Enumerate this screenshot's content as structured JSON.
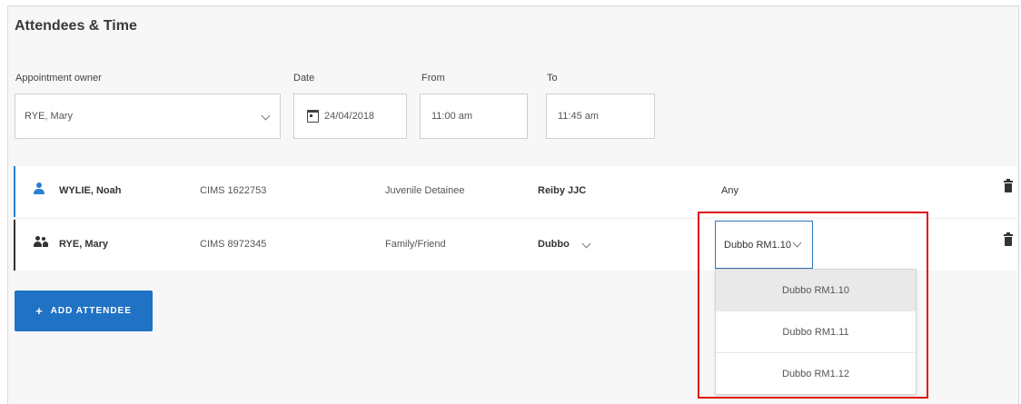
{
  "section": {
    "title": "Attendees & Time"
  },
  "form": {
    "owner_label": "Appointment owner",
    "owner_value": "RYE, Mary",
    "date_label": "Date",
    "date_value": "24/04/2018",
    "from_label": "From",
    "from_value": "11:00 am",
    "to_label": "To",
    "to_value": "11:45 am"
  },
  "attendees": [
    {
      "name": "WYLIE, Noah",
      "cims": "CIMS 1622753",
      "role": "Juvenile Detainee",
      "location": "Reiby JJC",
      "room": "Any",
      "icon": "person-icon"
    },
    {
      "name": "RYE, Mary",
      "cims": "CIMS 8972345",
      "role": "Family/Friend",
      "location": "Dubbo",
      "room": "Dubbo RM1.10",
      "icon": "group-icon"
    }
  ],
  "room_dropdown": {
    "options": [
      "Dubbo RM1.10",
      "Dubbo RM1.11",
      "Dubbo RM1.12"
    ],
    "selected": "Dubbo RM1.10"
  },
  "actions": {
    "add_attendee": "ADD ATTENDEE"
  },
  "colors": {
    "primary": "#1f72c4",
    "row_accent_1": "#2a7fd4",
    "row_accent_2": "#333333",
    "highlight": "#e01010"
  }
}
